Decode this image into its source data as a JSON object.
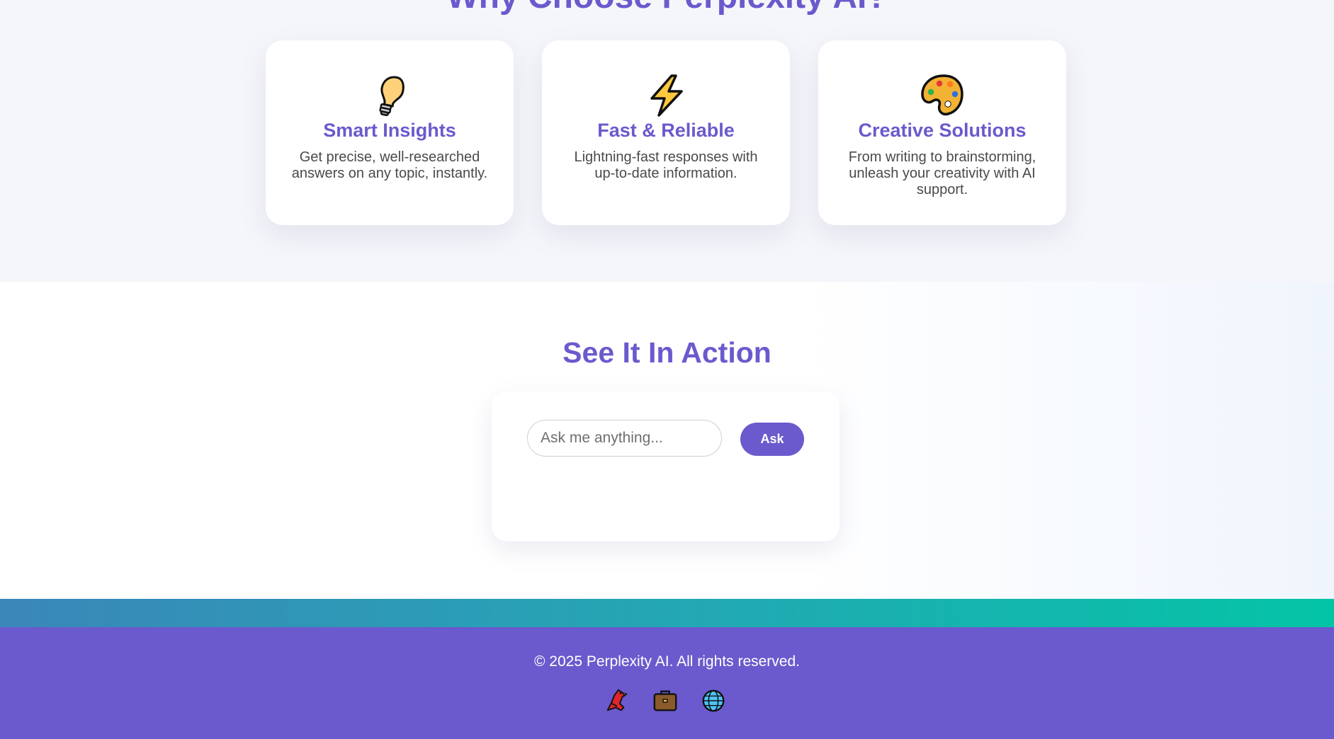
{
  "features": {
    "title": "Why Choose Perplexity AI?",
    "cards": [
      {
        "icon": "lightbulb-icon",
        "title": "Smart Insights",
        "description": "Get precise, well-researched answers on any topic, instantly."
      },
      {
        "icon": "lightning-icon",
        "title": "Fast & Reliable",
        "description": "Lightning-fast responses with up-to-date information."
      },
      {
        "icon": "palette-icon",
        "title": "Creative Solutions",
        "description": "From writing to brainstorming, unleash your creativity with AI support."
      }
    ]
  },
  "demo": {
    "title": "See It In Action",
    "input_placeholder": "Ask me anything...",
    "input_value": "",
    "ask_label": "Ask"
  },
  "footer": {
    "copyright": "© 2025 Perplexity AI. All rights reserved.",
    "social": [
      {
        "icon": "bird-icon"
      },
      {
        "icon": "briefcase-icon"
      },
      {
        "icon": "globe-icon"
      }
    ]
  },
  "colors": {
    "accent": "#6a5acd",
    "features_bg": "#f5f6fa",
    "strip_start": "#3a87b9",
    "strip_end": "#04c4a6",
    "footer_bg": "#6a5acd"
  }
}
